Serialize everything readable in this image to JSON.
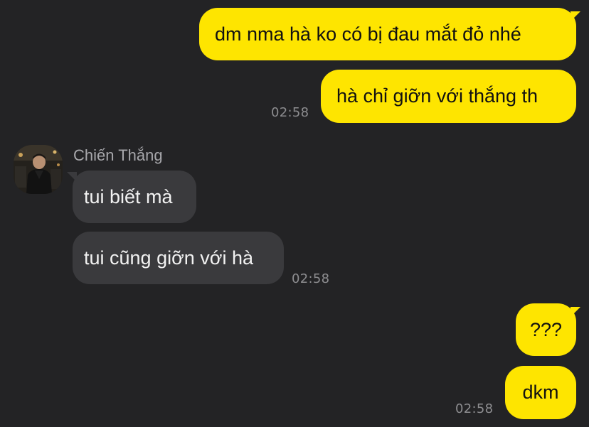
{
  "colors": {
    "background": "#232325",
    "outgoing_bubble": "#fee500",
    "incoming_bubble": "#3a3a3d",
    "timestamp": "#8d8d90",
    "sender_name": "#a7a7ab"
  },
  "conversation": {
    "outgoing_group_1": {
      "messages": [
        {
          "text": "dm nma hà ko có bị đau mắt đỏ nhé"
        },
        {
          "text": "hà chỉ giỡn với thắng th"
        }
      ],
      "time": "02:58"
    },
    "incoming_group": {
      "sender": "Chiến Thắng",
      "avatar": "profile-photo",
      "messages": [
        {
          "text": "tui biết mà"
        },
        {
          "text": "tui cũng giỡn với hà"
        }
      ],
      "time": "02:58"
    },
    "outgoing_group_2": {
      "messages": [
        {
          "text": "???"
        },
        {
          "text": "dkm"
        }
      ],
      "time": "02:58"
    }
  }
}
